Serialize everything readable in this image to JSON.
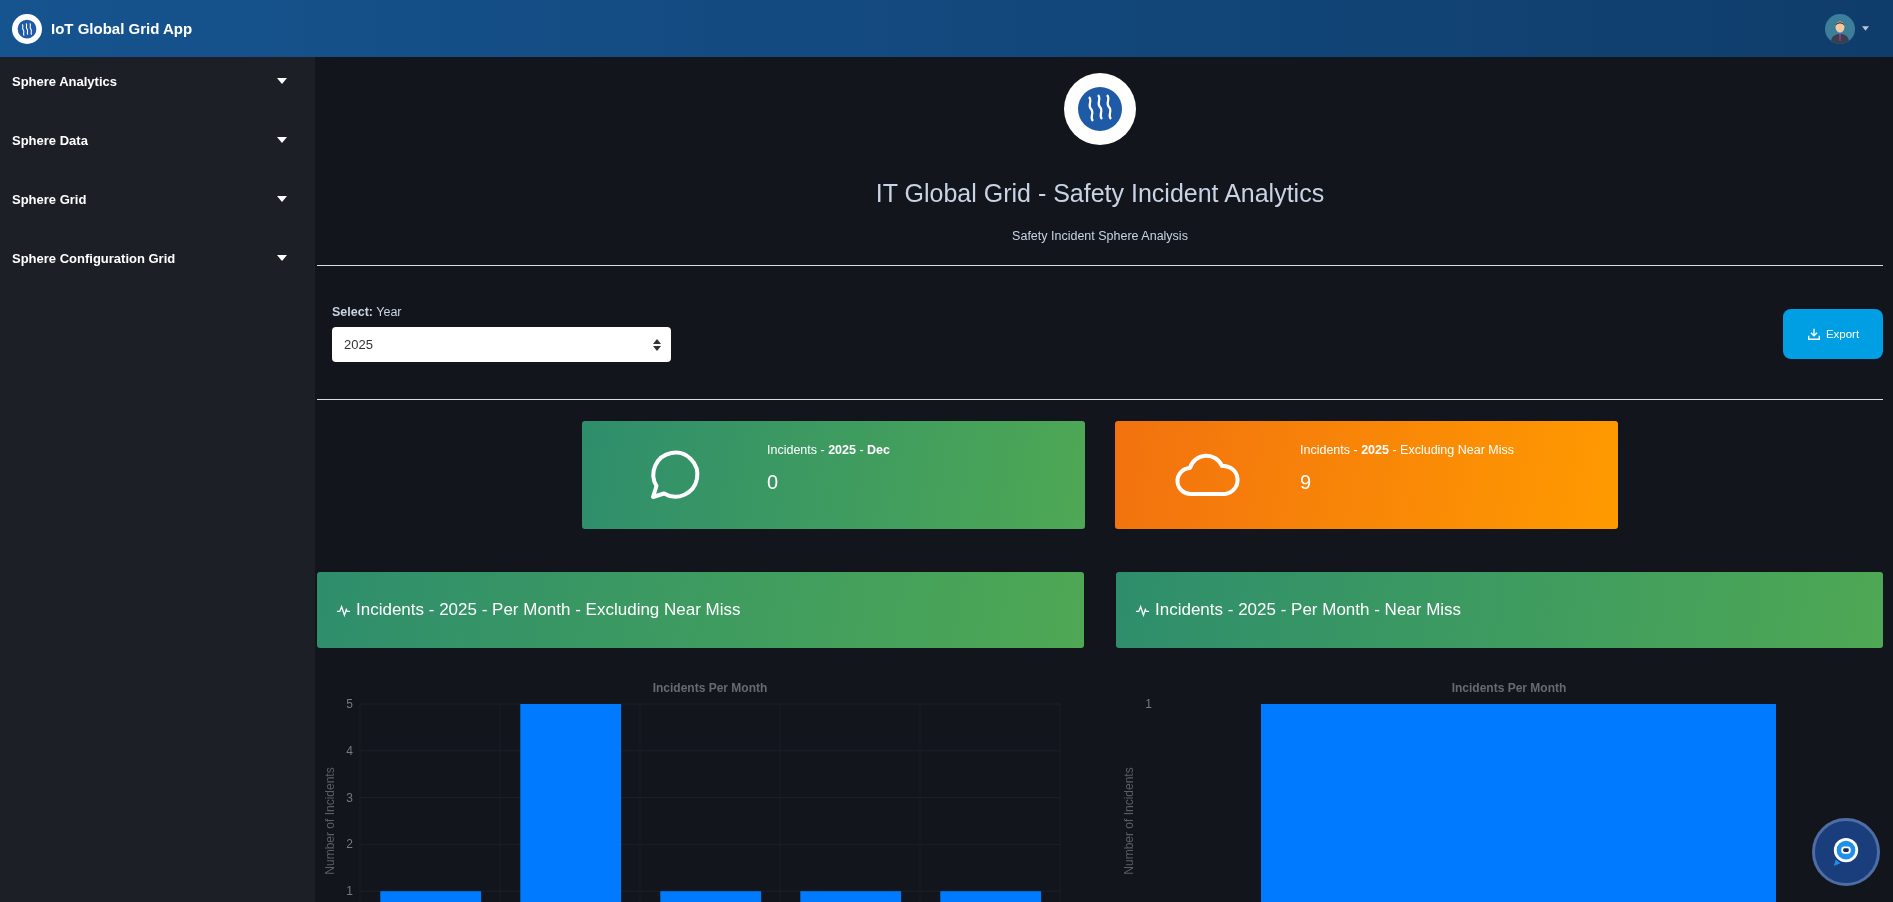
{
  "app": {
    "title": "IoT Global Grid App"
  },
  "sidebar": {
    "items": [
      {
        "label": "Sphere Analytics",
        "expanded": false
      },
      {
        "label": "Sphere Data",
        "expanded": false
      },
      {
        "label": "Sphere Grid",
        "expanded": false
      },
      {
        "label": "Sphere Configuration Grid",
        "expanded": false
      }
    ]
  },
  "header": {
    "title": "IT Global Grid - Safety Incident Analytics",
    "subtitle": "Safety Incident Sphere Analysis"
  },
  "filter": {
    "label": "**Select:** Year",
    "value": "2025"
  },
  "export_button": "Export",
  "stat_cards": [
    {
      "kind": "message",
      "label": "Incidents - **2025** - **Dec**",
      "value": "0"
    },
    {
      "kind": "cloud",
      "label": "Incidents - **2025** - Excluding Near Miss",
      "value": "9"
    }
  ],
  "charts": [
    {
      "title": "Incidents - 2025 - Per Month - Excluding Near Miss",
      "chart_data": {
        "type": "bar",
        "title": "Incidents Per Month",
        "ylabel": "Number of Incidents",
        "values": [
          1,
          5,
          1,
          1,
          1
        ],
        "ylim": [
          0,
          5
        ],
        "yticks": [
          1,
          2,
          3,
          4,
          5
        ],
        "grid": true
      }
    },
    {
      "title": "Incidents - 2025 - Per Month - Near Miss",
      "plot": {
        "title": "Incidents Per Month",
        "ylabel": "Number of Incidents",
        "y_tick_label": "1"
      }
    }
  ]
}
